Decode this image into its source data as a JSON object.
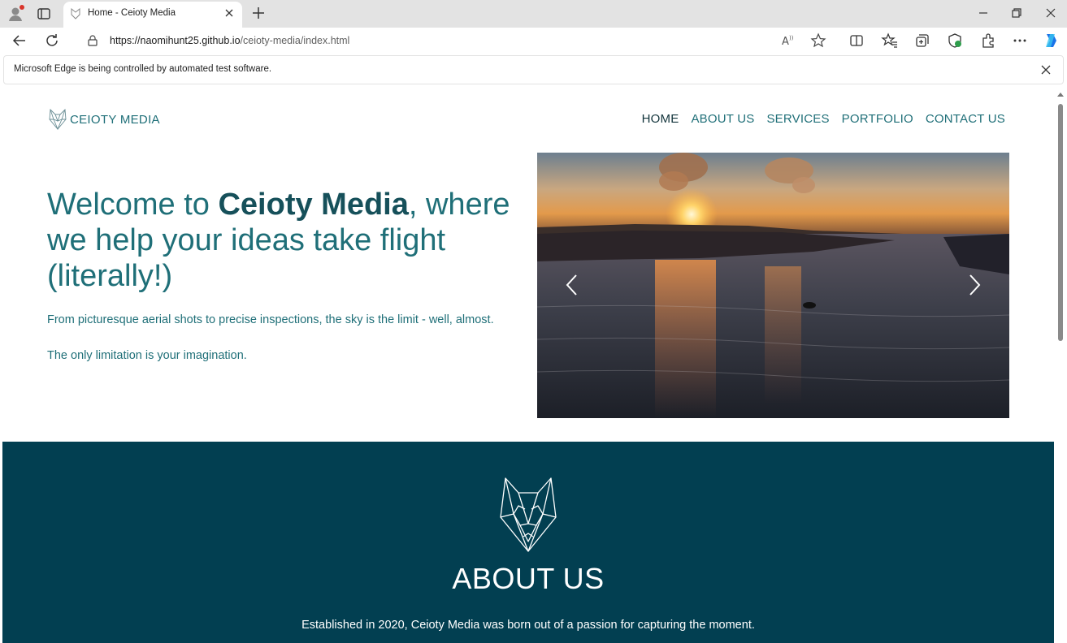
{
  "browser": {
    "tab_title": "Home - Ceioty Media",
    "url_host": "https://naomihunt25.github.io",
    "url_path": "/ceioty-media/index.html",
    "infobar_message": "Microsoft Edge is being controlled by automated test software.",
    "accent": "#1b73e8"
  },
  "site": {
    "logo_text": "CEIOTY MEDIA",
    "nav": [
      "HOME",
      "ABOUT US",
      "SERVICES",
      "PORTFOLIO",
      "CONTACT US"
    ],
    "hero": {
      "title_pre": "Welcome to ",
      "title_brand": "Ceioty Media",
      "title_post": ", where we help your ideas take flight (literally!)",
      "line1": "From picturesque aerial shots to precise inspections, the sky is the limit - well, almost.",
      "line2": "The only limitation is your imagination."
    },
    "about": {
      "heading": "ABOUT US",
      "text": "Established in 2020, Ceioty Media was born out of a passion for capturing the moment."
    },
    "colors": {
      "teal": "#1f6f78",
      "dark_teal": "#023f51"
    }
  }
}
